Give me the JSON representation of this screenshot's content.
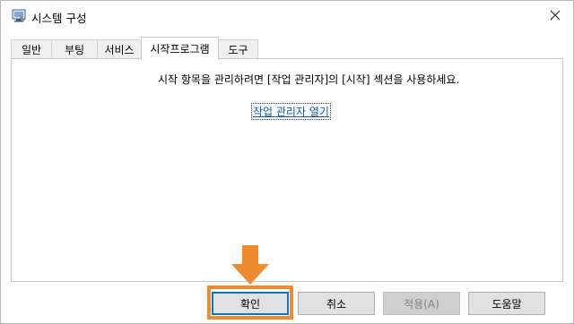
{
  "window": {
    "title": "시스템 구성",
    "icon": "system-config-icon",
    "close_icon": "close-icon"
  },
  "tabs": [
    {
      "label": "일반",
      "active": false
    },
    {
      "label": "부팅",
      "active": false
    },
    {
      "label": "서비스",
      "active": false
    },
    {
      "label": "시작프로그램",
      "active": true
    },
    {
      "label": "도구",
      "active": false
    }
  ],
  "startup": {
    "message": "시작 항목을 관리하려면 [작업 관리자]의 [시작] 섹션을 사용하세요.",
    "link_label": "작업 관리자 열기"
  },
  "buttons": {
    "ok": "확인",
    "cancel": "취소",
    "apply": "적용(A)",
    "help": "도움말"
  },
  "annotation": {
    "arrow_icon": "down-arrow-icon",
    "color": "#ef8a2e"
  }
}
